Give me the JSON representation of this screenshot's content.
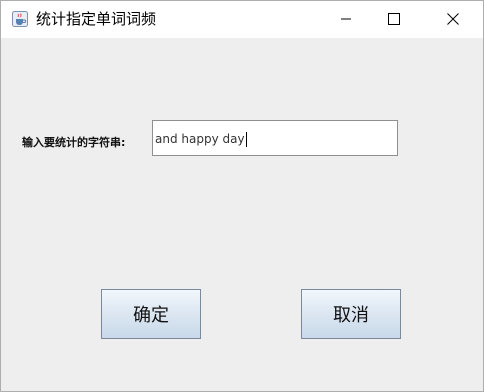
{
  "window": {
    "title": "统计指定单词词频",
    "icon": "java-cup-icon"
  },
  "form": {
    "prompt_label": "输入要统计的字符串:",
    "input_value": "and happy day"
  },
  "buttons": {
    "ok_label": "确定",
    "cancel_label": "取消"
  },
  "controls": {
    "minimize_icon": "minimize-icon",
    "maximize_icon": "maximize-icon",
    "close_icon": "close-icon"
  }
}
